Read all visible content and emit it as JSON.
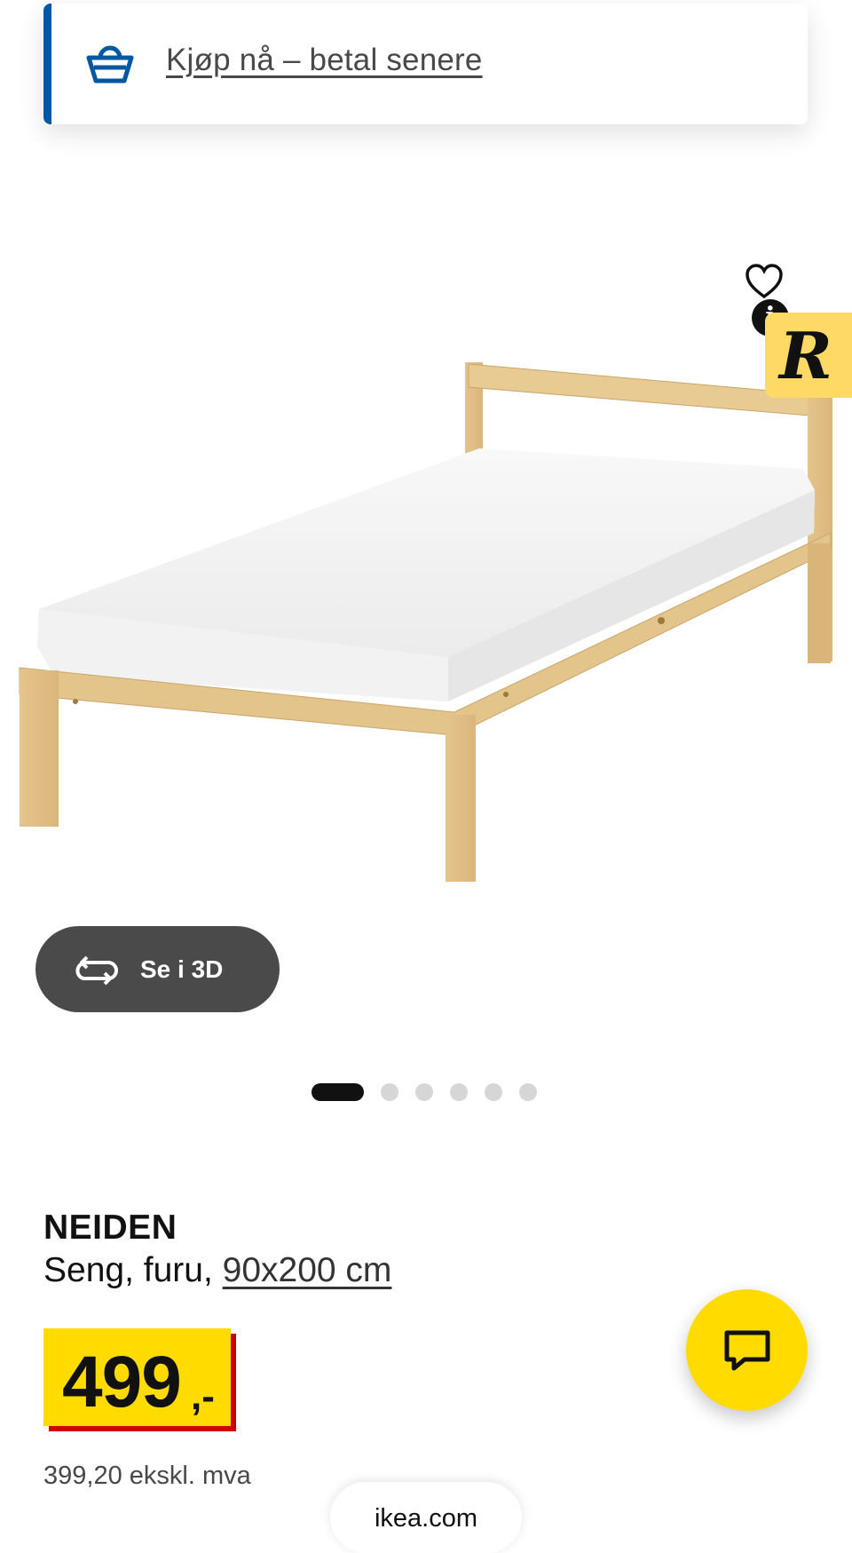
{
  "banner": {
    "link_label": "Kjøp nå – betal senere",
    "accent_color": "#0058a3",
    "icon": "basket-icon"
  },
  "gallery": {
    "image_alt": "NEIDEN pine bed frame with white mattress",
    "view_3d_label": "Se i 3D",
    "slide_count": 6,
    "active_slide": 1,
    "favorite_icon": "heart-icon",
    "info_icon": "info-icon",
    "badge_letter": "R"
  },
  "product": {
    "name": "NEIDEN",
    "description_prefix": "Seng, furu, ",
    "size_link": "90x200 cm",
    "price_number": "499",
    "price_suffix": ",-",
    "price_ex_vat": "399,20 ekskl. mva",
    "price_color": "#ffdb00",
    "price_shadow_color": "#cc0008"
  },
  "chat": {
    "icon": "chat-icon",
    "color": "#ffdb00"
  },
  "browser": {
    "url": "ikea.com"
  }
}
